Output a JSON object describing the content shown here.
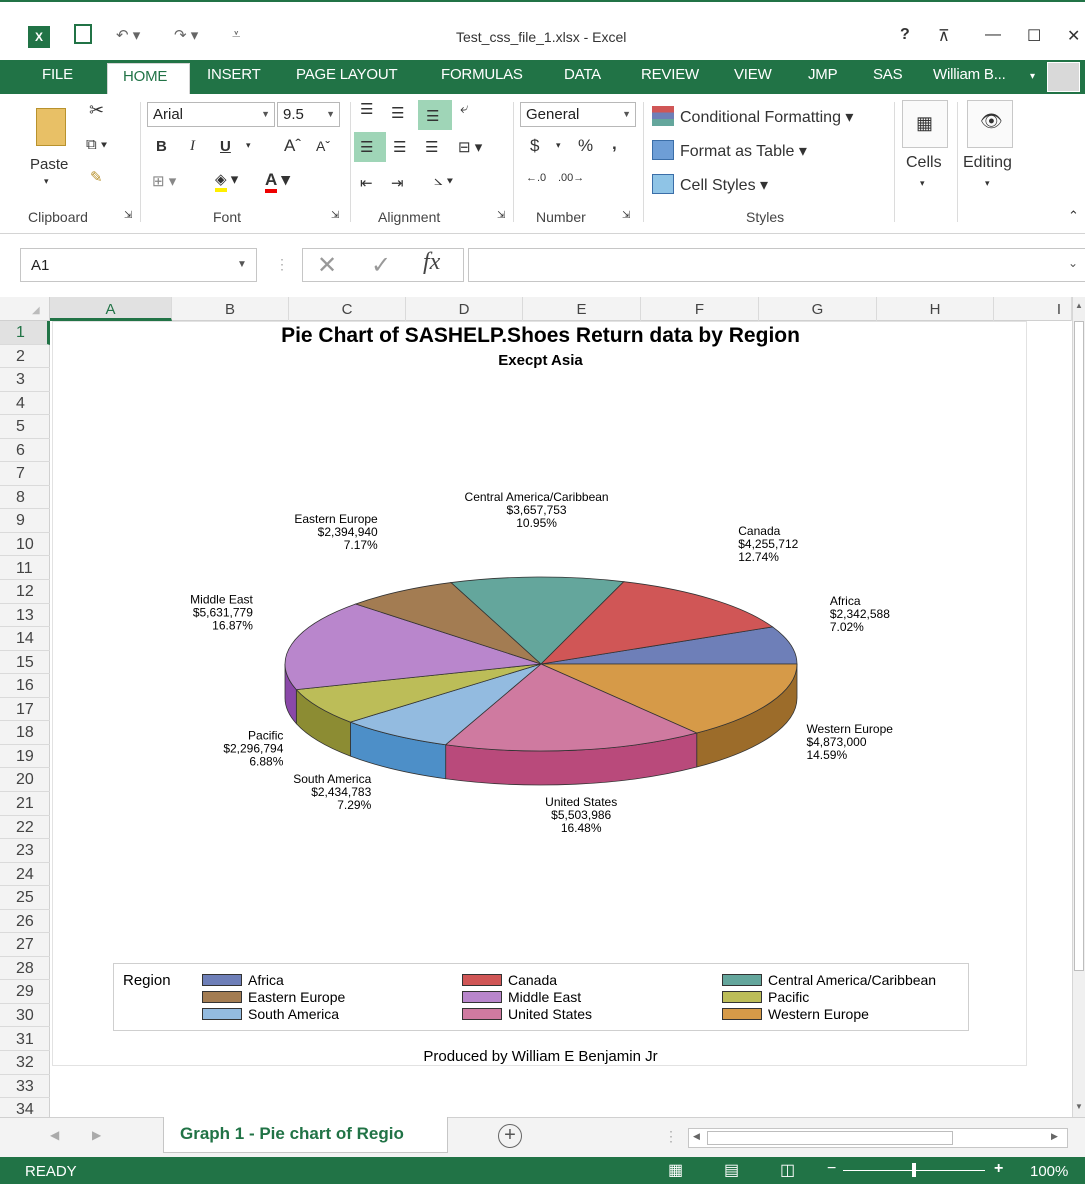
{
  "app": {
    "title": "Test_css_file_1.xlsx - Excel",
    "help": "?",
    "user": "William B...",
    "brand_color": "#217346"
  },
  "tabs": [
    {
      "label": "FILE"
    },
    {
      "label": "HOME"
    },
    {
      "label": "INSERT"
    },
    {
      "label": "PAGE LAYOUT"
    },
    {
      "label": "FORMULAS"
    },
    {
      "label": "DATA"
    },
    {
      "label": "REVIEW"
    },
    {
      "label": "VIEW"
    },
    {
      "label": "JMP"
    },
    {
      "label": "SAS"
    }
  ],
  "ribbon": {
    "clipboard": {
      "paste": "Paste",
      "label": "Clipboard"
    },
    "font": {
      "name": "Arial",
      "size": "9.5",
      "label": "Font",
      "bold": "B",
      "italic": "I",
      "underline": "U"
    },
    "alignment": {
      "label": "Alignment"
    },
    "number": {
      "format": "General",
      "currency": "$",
      "percent": "%",
      "comma": ",",
      "label": "Number"
    },
    "styles": {
      "conditional": "Conditional Formatting",
      "format_table": "Format as Table",
      "cell_styles": "Cell Styles",
      "label": "Styles"
    },
    "cells": {
      "label": "Cells"
    },
    "editing": {
      "label": "Editing"
    }
  },
  "formula_bar": {
    "name_box": "A1",
    "fx": "fx",
    "value": ""
  },
  "grid": {
    "columns": [
      "A",
      "B",
      "C",
      "D",
      "E",
      "F",
      "G",
      "H",
      "I"
    ],
    "rows": [
      "1",
      "2",
      "3",
      "4",
      "5",
      "6",
      "7",
      "8",
      "9",
      "10",
      "11",
      "12",
      "13",
      "14",
      "15",
      "16",
      "17",
      "18",
      "19",
      "20",
      "21",
      "22",
      "23",
      "24",
      "25",
      "26",
      "27",
      "28",
      "29",
      "30",
      "31",
      "32",
      "33",
      "34"
    ],
    "selected_column": "A",
    "selected_row": "1"
  },
  "chart_data": {
    "type": "pie",
    "title": "Pie Chart of SASHELP.Shoes Return data by Region",
    "subtitle": "Execpt Asia",
    "legend_title": "Region",
    "legend_position": "bottom",
    "footnote": "Produced by William E Benjamin Jr",
    "slices": [
      {
        "name": "Africa",
        "value": "$2,342,588",
        "percent": "7.02%",
        "pct": 7.02,
        "color": "#6e7fb8",
        "side": "#4f5c8a"
      },
      {
        "name": "Western Europe",
        "value": "$4,873,000",
        "percent": "14.59%",
        "pct": 14.59,
        "color": "#d69a48",
        "side": "#9c6c2a"
      },
      {
        "name": "United States",
        "value": "$5,503,986",
        "percent": "16.48%",
        "pct": 16.48,
        "color": "#cf7aa0",
        "side": "#b94a7b"
      },
      {
        "name": "South America",
        "value": "$2,434,783",
        "percent": "7.29%",
        "pct": 7.29,
        "color": "#93bbe0",
        "side": "#4d8fc8"
      },
      {
        "name": "Pacific",
        "value": "$2,296,794",
        "percent": "6.88%",
        "pct": 6.88,
        "color": "#bcbd58",
        "side": "#8c8c33"
      },
      {
        "name": "Middle East",
        "value": "$5,631,779",
        "percent": "16.87%",
        "pct": 16.87,
        "color": "#b986cc",
        "side": "#8a48a8"
      },
      {
        "name": "Eastern Europe",
        "value": "$2,394,940",
        "percent": "7.17%",
        "pct": 7.17,
        "color": "#a37c52",
        "side": "#7a5a38"
      },
      {
        "name": "Central America/Caribbean",
        "value": "$3,657,753",
        "percent": "10.95%",
        "pct": 10.95,
        "color": "#64a69c",
        "side": "#3f7a72"
      },
      {
        "name": "Canada",
        "value": "$4,255,712",
        "percent": "12.74%",
        "pct": 12.74,
        "color": "#d05656",
        "side": "#a13c3c"
      }
    ],
    "legend_order": [
      "Africa",
      "Canada",
      "Central America/Caribbean",
      "Eastern Europe",
      "Middle East",
      "Pacific",
      "South America",
      "United States",
      "Western Europe"
    ]
  },
  "sheet_tabs": {
    "active": "Graph 1 - Pie chart of Regio",
    "add": "+"
  },
  "status": {
    "text": "READY",
    "zoom": "100%"
  }
}
